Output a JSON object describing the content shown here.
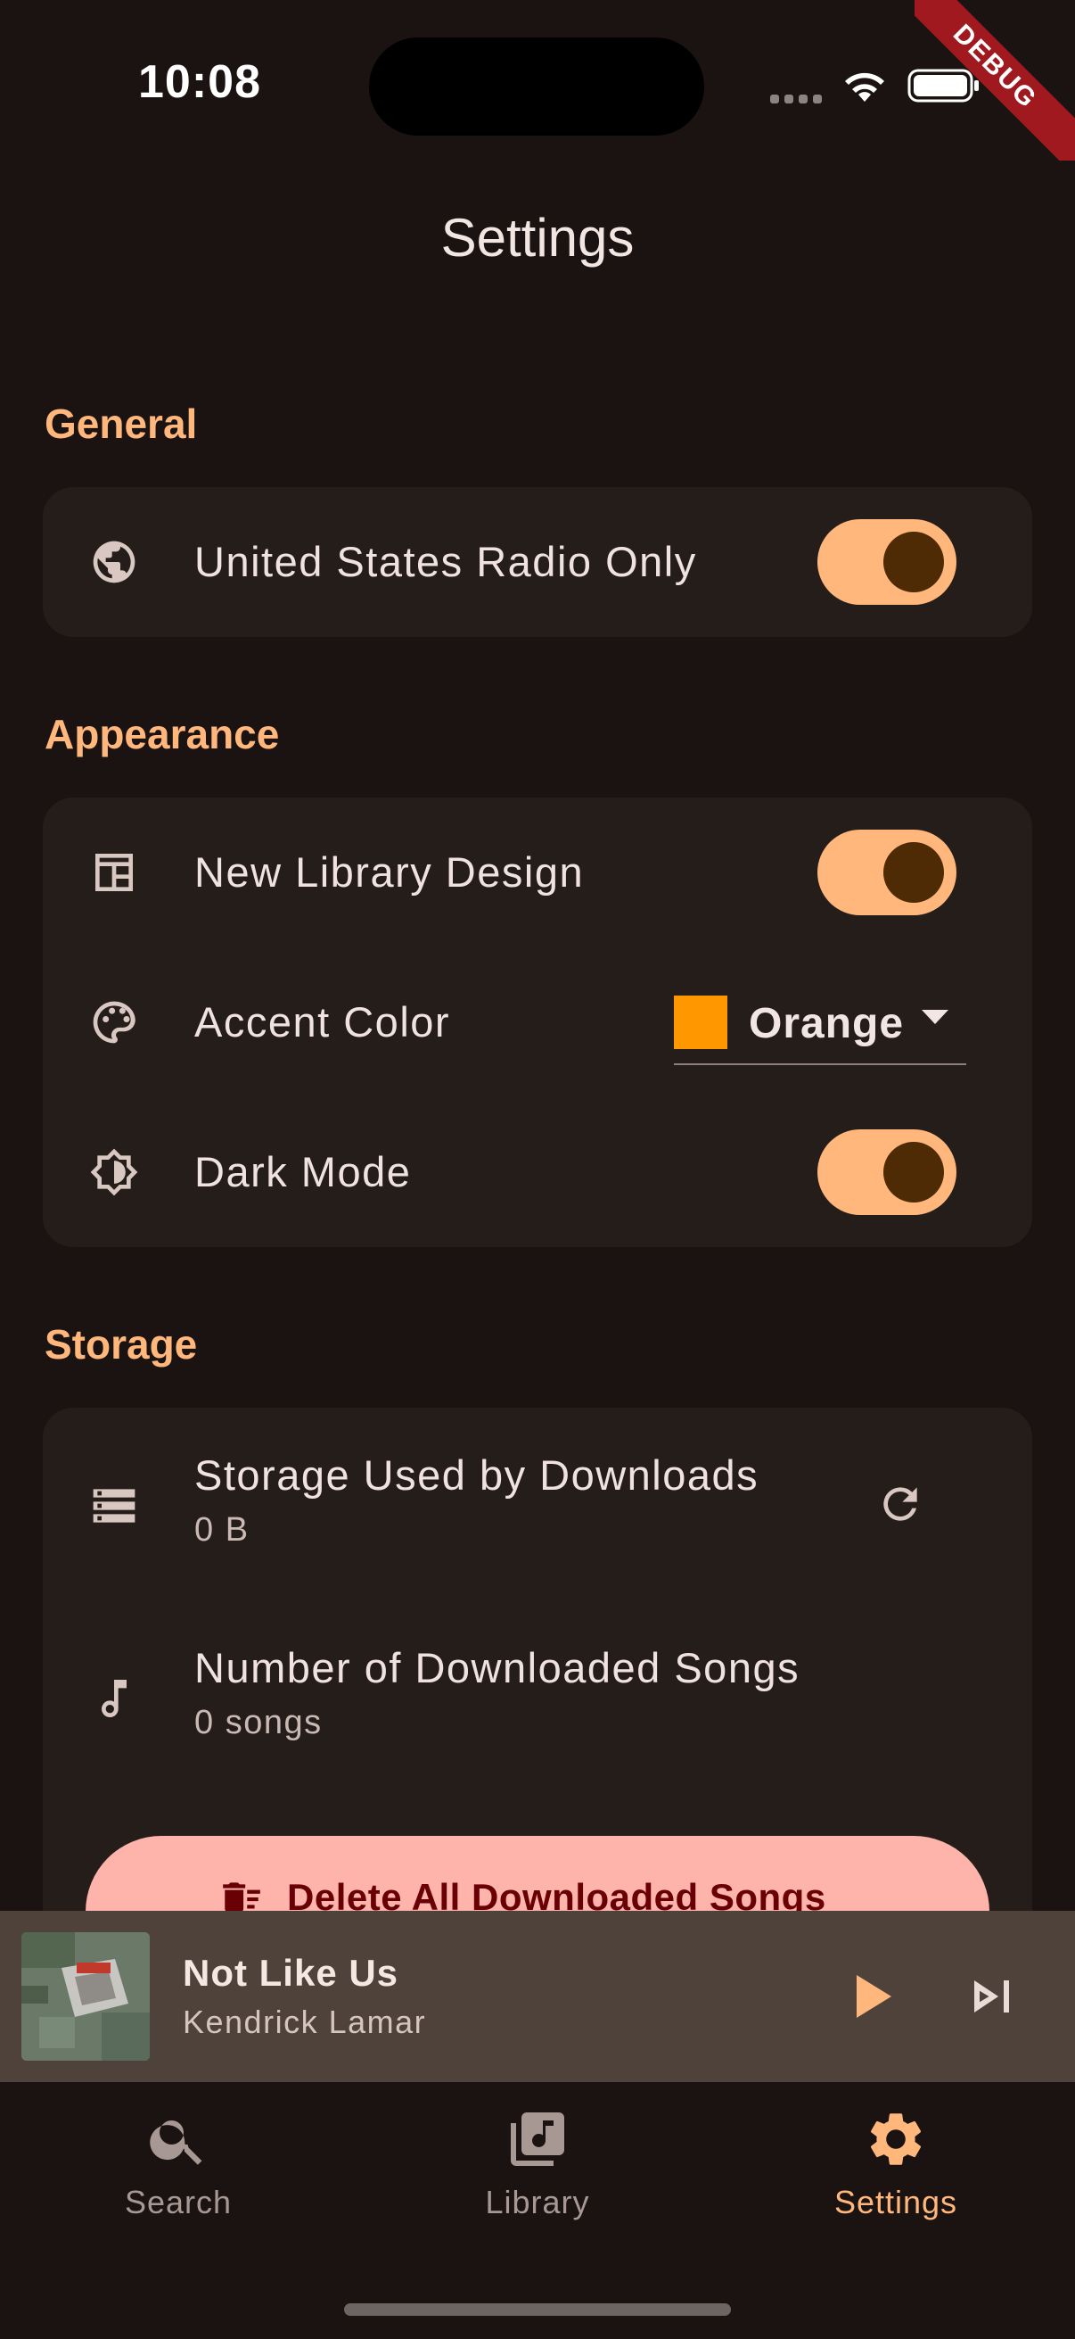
{
  "status_bar": {
    "time": "10:08",
    "debug_banner": "DEBUG"
  },
  "page": {
    "title": "Settings"
  },
  "colors": {
    "accent": "#ffb77c",
    "background": "#1b1311",
    "card": "#251d1a",
    "accent_swatch": "#ff9800",
    "danger_bg": "#ffb4ab",
    "danger_fg": "#690005",
    "miniplayer_bg": "#4e423a"
  },
  "general": {
    "label": "General",
    "radio_only": {
      "label": "United States Radio Only",
      "icon": "globe-icon",
      "enabled": true
    }
  },
  "appearance": {
    "label": "Appearance",
    "new_library": {
      "label": "New Library Design",
      "icon": "library-layout-icon",
      "enabled": true
    },
    "accent_color": {
      "label": "Accent Color",
      "icon": "palette-icon",
      "value": "Orange"
    },
    "dark_mode": {
      "label": "Dark Mode",
      "icon": "brightness-icon",
      "enabled": true
    }
  },
  "storage": {
    "label": "Storage",
    "used": {
      "label": "Storage Used by Downloads",
      "value": "0 B",
      "icon": "storage-icon"
    },
    "count": {
      "label": "Number of Downloaded Songs",
      "value": "0 songs",
      "icon": "music-note-icon"
    },
    "delete_button": "Delete All Downloaded Songs"
  },
  "now_playing": {
    "title": "Not Like Us",
    "artist": "Kendrick Lamar"
  },
  "nav": {
    "search": "Search",
    "library": "Library",
    "settings": "Settings",
    "active": "settings"
  }
}
